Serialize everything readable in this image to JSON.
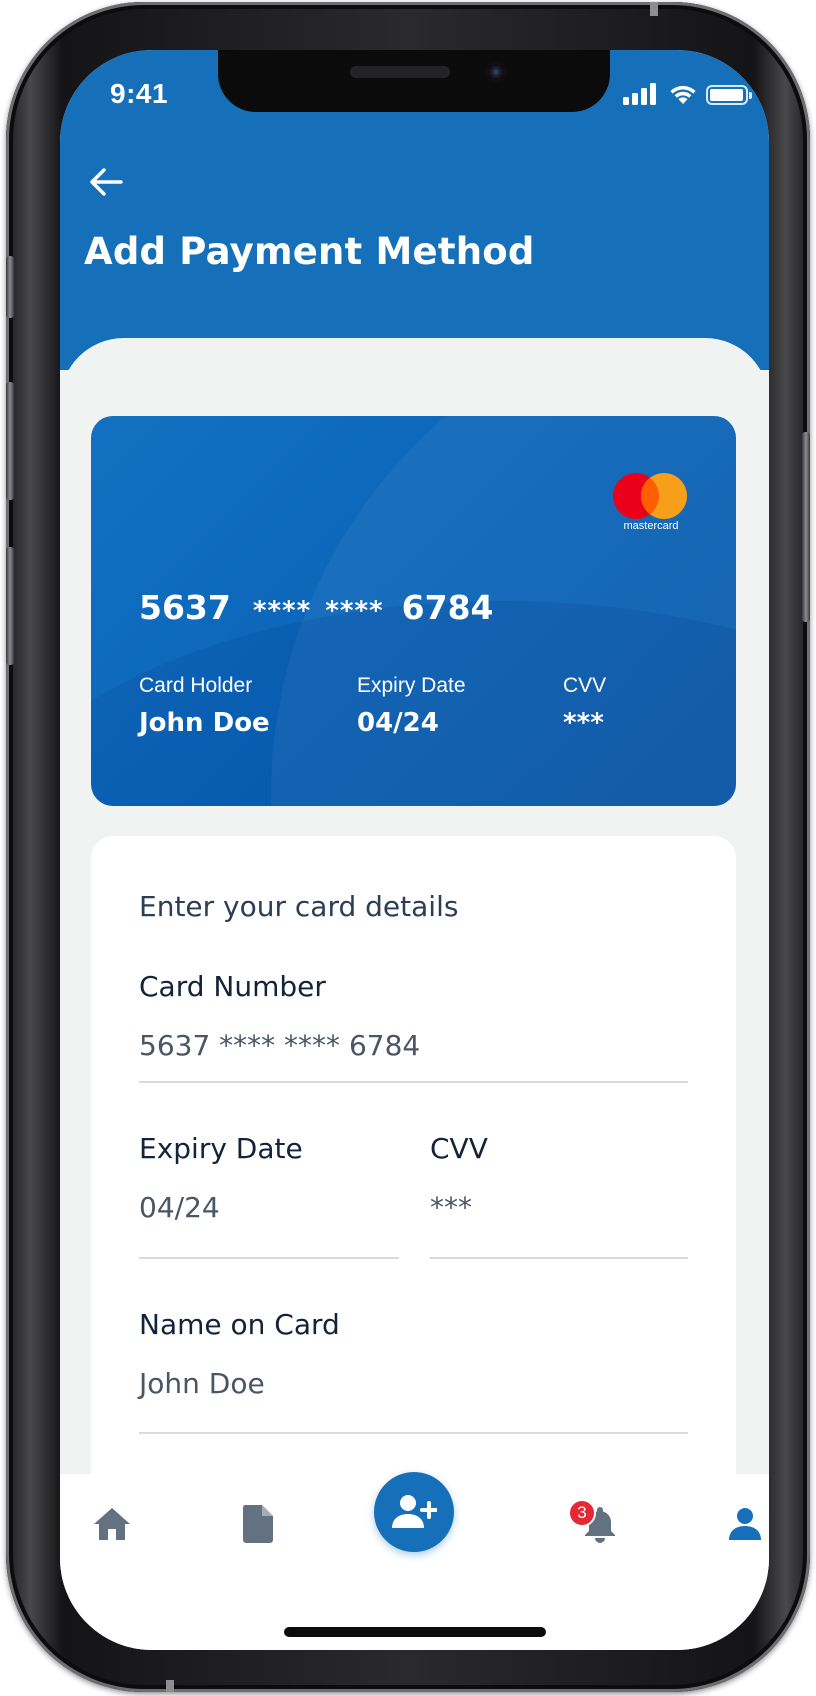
{
  "status_bar": {
    "time": "9:41"
  },
  "header": {
    "title": "Add Payment Method",
    "back_icon": "arrow-left-icon"
  },
  "card_preview": {
    "brand": "mastercard",
    "number_first": "5637",
    "number_mask_1": "****",
    "number_mask_2": "****",
    "number_last": "6784",
    "holder_label": "Card Holder",
    "holder_value": "John Doe",
    "expiry_label": "Expiry Date",
    "expiry_value": "04/24",
    "cvv_label": "CVV",
    "cvv_value": "***",
    "colors": {
      "card_background": "#0a63b7",
      "mastercard_red": "#eb001b",
      "mastercard_orange": "#f79e1b"
    }
  },
  "form": {
    "heading": "Enter your card details",
    "card_number_label": "Card Number",
    "card_number_value": "5637 **** **** 6784",
    "expiry_label": "Expiry Date",
    "expiry_value": "04/24",
    "cvv_label": "CVV",
    "cvv_value": "***",
    "name_label": "Name on Card",
    "name_value": "John Doe"
  },
  "bottom_nav": {
    "items": [
      {
        "icon": "home-icon"
      },
      {
        "icon": "document-icon"
      },
      {
        "icon": "add-user-icon"
      },
      {
        "icon": "bell-icon",
        "badge": "3"
      },
      {
        "icon": "user-icon",
        "active": true
      }
    ],
    "accent_color": "#1570b9",
    "inactive_color": "#637180"
  }
}
